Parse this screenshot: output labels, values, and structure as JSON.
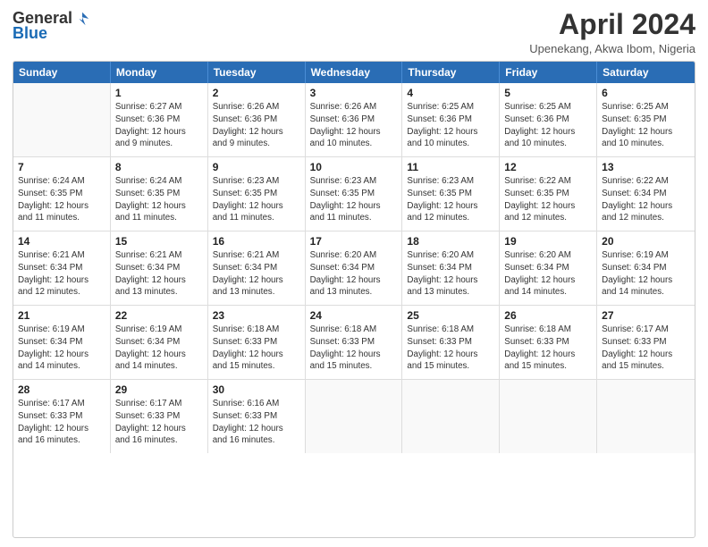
{
  "logo": {
    "general": "General",
    "blue": "Blue"
  },
  "title": "April 2024",
  "subtitle": "Upenekang, Akwa Ibom, Nigeria",
  "header_days": [
    "Sunday",
    "Monday",
    "Tuesday",
    "Wednesday",
    "Thursday",
    "Friday",
    "Saturday"
  ],
  "weeks": [
    [
      {
        "day": "",
        "info": ""
      },
      {
        "day": "1",
        "info": "Sunrise: 6:27 AM\nSunset: 6:36 PM\nDaylight: 12 hours\nand 9 minutes."
      },
      {
        "day": "2",
        "info": "Sunrise: 6:26 AM\nSunset: 6:36 PM\nDaylight: 12 hours\nand 9 minutes."
      },
      {
        "day": "3",
        "info": "Sunrise: 6:26 AM\nSunset: 6:36 PM\nDaylight: 12 hours\nand 10 minutes."
      },
      {
        "day": "4",
        "info": "Sunrise: 6:25 AM\nSunset: 6:36 PM\nDaylight: 12 hours\nand 10 minutes."
      },
      {
        "day": "5",
        "info": "Sunrise: 6:25 AM\nSunset: 6:36 PM\nDaylight: 12 hours\nand 10 minutes."
      },
      {
        "day": "6",
        "info": "Sunrise: 6:25 AM\nSunset: 6:35 PM\nDaylight: 12 hours\nand 10 minutes."
      }
    ],
    [
      {
        "day": "7",
        "info": "Sunrise: 6:24 AM\nSunset: 6:35 PM\nDaylight: 12 hours\nand 11 minutes."
      },
      {
        "day": "8",
        "info": "Sunrise: 6:24 AM\nSunset: 6:35 PM\nDaylight: 12 hours\nand 11 minutes."
      },
      {
        "day": "9",
        "info": "Sunrise: 6:23 AM\nSunset: 6:35 PM\nDaylight: 12 hours\nand 11 minutes."
      },
      {
        "day": "10",
        "info": "Sunrise: 6:23 AM\nSunset: 6:35 PM\nDaylight: 12 hours\nand 11 minutes."
      },
      {
        "day": "11",
        "info": "Sunrise: 6:23 AM\nSunset: 6:35 PM\nDaylight: 12 hours\nand 12 minutes."
      },
      {
        "day": "12",
        "info": "Sunrise: 6:22 AM\nSunset: 6:35 PM\nDaylight: 12 hours\nand 12 minutes."
      },
      {
        "day": "13",
        "info": "Sunrise: 6:22 AM\nSunset: 6:34 PM\nDaylight: 12 hours\nand 12 minutes."
      }
    ],
    [
      {
        "day": "14",
        "info": "Sunrise: 6:21 AM\nSunset: 6:34 PM\nDaylight: 12 hours\nand 12 minutes."
      },
      {
        "day": "15",
        "info": "Sunrise: 6:21 AM\nSunset: 6:34 PM\nDaylight: 12 hours\nand 13 minutes."
      },
      {
        "day": "16",
        "info": "Sunrise: 6:21 AM\nSunset: 6:34 PM\nDaylight: 12 hours\nand 13 minutes."
      },
      {
        "day": "17",
        "info": "Sunrise: 6:20 AM\nSunset: 6:34 PM\nDaylight: 12 hours\nand 13 minutes."
      },
      {
        "day": "18",
        "info": "Sunrise: 6:20 AM\nSunset: 6:34 PM\nDaylight: 12 hours\nand 13 minutes."
      },
      {
        "day": "19",
        "info": "Sunrise: 6:20 AM\nSunset: 6:34 PM\nDaylight: 12 hours\nand 14 minutes."
      },
      {
        "day": "20",
        "info": "Sunrise: 6:19 AM\nSunset: 6:34 PM\nDaylight: 12 hours\nand 14 minutes."
      }
    ],
    [
      {
        "day": "21",
        "info": "Sunrise: 6:19 AM\nSunset: 6:34 PM\nDaylight: 12 hours\nand 14 minutes."
      },
      {
        "day": "22",
        "info": "Sunrise: 6:19 AM\nSunset: 6:34 PM\nDaylight: 12 hours\nand 14 minutes."
      },
      {
        "day": "23",
        "info": "Sunrise: 6:18 AM\nSunset: 6:33 PM\nDaylight: 12 hours\nand 15 minutes."
      },
      {
        "day": "24",
        "info": "Sunrise: 6:18 AM\nSunset: 6:33 PM\nDaylight: 12 hours\nand 15 minutes."
      },
      {
        "day": "25",
        "info": "Sunrise: 6:18 AM\nSunset: 6:33 PM\nDaylight: 12 hours\nand 15 minutes."
      },
      {
        "day": "26",
        "info": "Sunrise: 6:18 AM\nSunset: 6:33 PM\nDaylight: 12 hours\nand 15 minutes."
      },
      {
        "day": "27",
        "info": "Sunrise: 6:17 AM\nSunset: 6:33 PM\nDaylight: 12 hours\nand 15 minutes."
      }
    ],
    [
      {
        "day": "28",
        "info": "Sunrise: 6:17 AM\nSunset: 6:33 PM\nDaylight: 12 hours\nand 16 minutes."
      },
      {
        "day": "29",
        "info": "Sunrise: 6:17 AM\nSunset: 6:33 PM\nDaylight: 12 hours\nand 16 minutes."
      },
      {
        "day": "30",
        "info": "Sunrise: 6:16 AM\nSunset: 6:33 PM\nDaylight: 12 hours\nand 16 minutes."
      },
      {
        "day": "",
        "info": ""
      },
      {
        "day": "",
        "info": ""
      },
      {
        "day": "",
        "info": ""
      },
      {
        "day": "",
        "info": ""
      }
    ]
  ]
}
